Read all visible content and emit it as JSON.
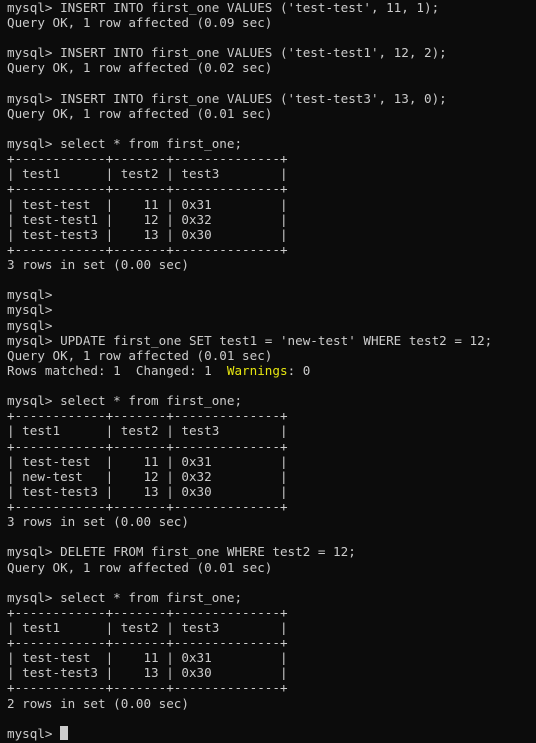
{
  "terminal": {
    "lines": [
      "mysql> INSERT INTO first_one VALUES ('test-test', 11, 1);",
      "Query OK, 1 row affected (0.09 sec)",
      "",
      "mysql> INSERT INTO first_one VALUES ('test-test1', 12, 2);",
      "Query OK, 1 row affected (0.02 sec)",
      "",
      "mysql> INSERT INTO first_one VALUES ('test-test3', 13, 0);",
      "Query OK, 1 row affected (0.01 sec)",
      "",
      "mysql> select * from first_one;",
      "+------------+-------+--------------+",
      "| test1      | test2 | test3        |",
      "+------------+-------+--------------+",
      "| test-test  |    11 | 0x31         |",
      "| test-test1 |    12 | 0x32         |",
      "| test-test3 |    13 | 0x30         |",
      "+------------+-------+--------------+",
      "3 rows in set (0.00 sec)",
      "",
      "mysql>",
      "mysql>",
      "mysql>",
      "mysql> UPDATE first_one SET test1 = 'new-test' WHERE test2 = 12;",
      "Query OK, 1 row affected (0.01 sec)",
      "ROWS_MATCHED_LINE",
      "",
      "mysql> select * from first_one;",
      "+------------+-------+--------------+",
      "| test1      | test2 | test3        |",
      "+------------+-------+--------------+",
      "| test-test  |    11 | 0x31         |",
      "| new-test   |    12 | 0x32         |",
      "| test-test3 |    13 | 0x30         |",
      "+------------+-------+--------------+",
      "3 rows in set (0.00 sec)",
      "",
      "mysql> DELETE FROM first_one WHERE test2 = 12;",
      "Query OK, 1 row affected (0.01 sec)",
      "",
      "mysql> select * from first_one;",
      "+------------+-------+--------------+",
      "| test1      | test2 | test3        |",
      "+------------+-------+--------------+",
      "| test-test  |    11 | 0x31         |",
      "| test-test3 |    13 | 0x30         |",
      "+------------+-------+--------------+",
      "2 rows in set (0.00 sec)",
      "",
      "PROMPT_LINE"
    ],
    "rows_matched": {
      "prefix": "Rows matched: 1  Changed: 1  ",
      "warnings_label": "Warnings",
      "suffix": ": 0"
    },
    "prompt": "mysql> ",
    "colors": {
      "background": "#0c0c0c",
      "text": "#cccccc",
      "warning": "#e5e510"
    }
  }
}
